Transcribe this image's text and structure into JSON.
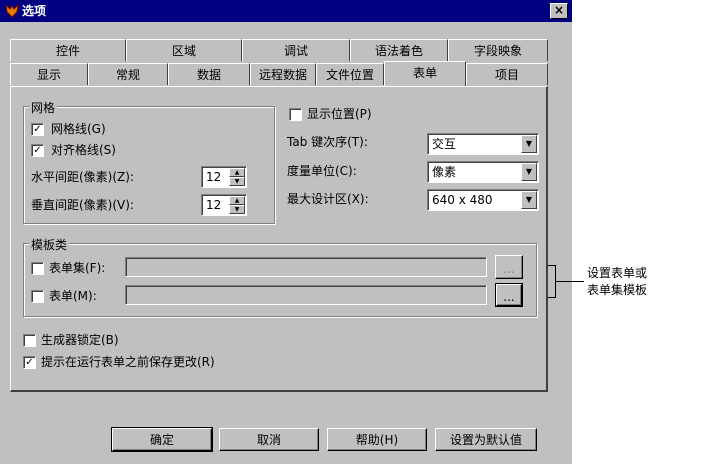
{
  "window": {
    "title": "选项",
    "close_glyph": "×"
  },
  "tabs_row1": [
    "控件",
    "区域",
    "调试",
    "语法着色",
    "字段映象"
  ],
  "tabs_row2": [
    "显示",
    "常规",
    "数据",
    "远程数据",
    "文件位置",
    "表单",
    "项目"
  ],
  "grid": {
    "legend": "网格",
    "show_grid": {
      "label": "网格线(G)",
      "checked": true
    },
    "snap_grid": {
      "label": "对齐格线(S)",
      "checked": true
    },
    "horizontal_label": "水平间距(像素)(Z):",
    "horizontal_value": "12",
    "vertical_label": "垂直间距(像素)(V):",
    "vertical_value": "12"
  },
  "show_position": {
    "label": "显示位置(P)",
    "checked": false
  },
  "tab_order": {
    "label": "Tab 键次序(T):",
    "value": "交互"
  },
  "scale_units": {
    "label": "度量单位(C):",
    "value": "像素"
  },
  "max_design": {
    "label": "最大设计区(X):",
    "value": "640 x 480"
  },
  "templates": {
    "legend": "模板类",
    "formset": {
      "label": "表单集(F):",
      "checked": false,
      "value": "",
      "browse": "..."
    },
    "form": {
      "label": "表单(M):",
      "checked": false,
      "value": "",
      "browse": "..."
    }
  },
  "builder_lock": {
    "label": "生成器锁定(B)",
    "checked": false
  },
  "prompt_save": {
    "label": "提示在运行表单之前保存更改(R)",
    "checked": true
  },
  "buttons": {
    "ok": "确定",
    "cancel": "取消",
    "help": "帮助(H)",
    "set_default": "设置为默认值"
  },
  "annotation": {
    "line1": "设置表单或",
    "line2": "表单集模板"
  },
  "check_glyph": "✓",
  "spin_up": "▲",
  "spin_down": "▼",
  "dropdown_glyph": "▼"
}
